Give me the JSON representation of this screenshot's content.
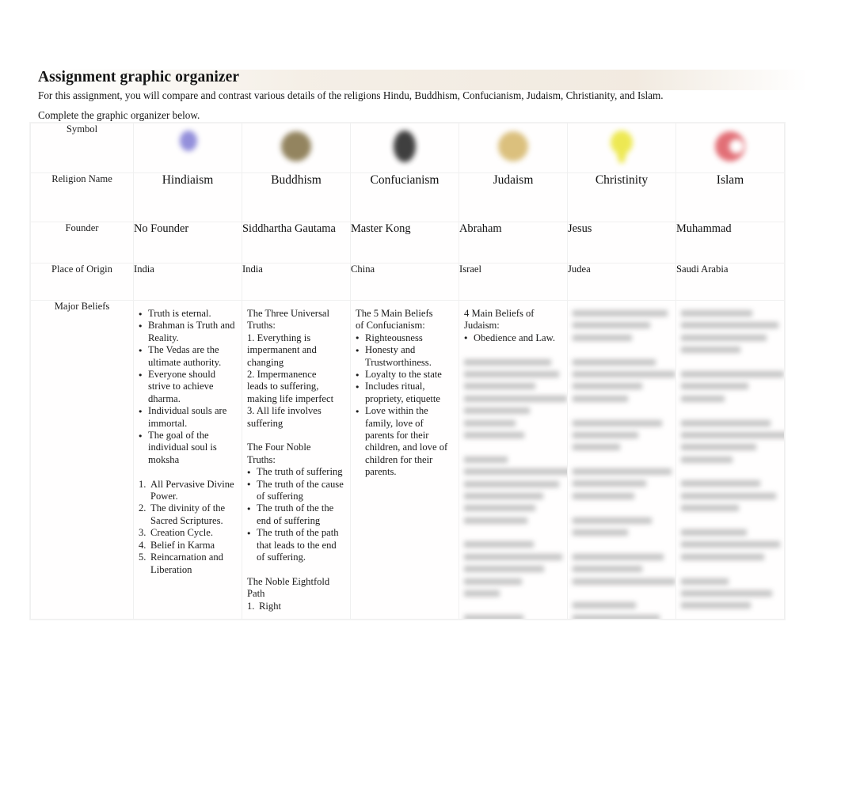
{
  "document": {
    "title": "Assignment graphic organizer",
    "intro_line_1": "For this assignment, you will compare and contrast various details of the religions Hindu, Buddhism, Confucianism, Judaism, Christianity, and Islam.",
    "intro_line_2": "Complete the graphic organizer below."
  },
  "table": {
    "row_labels": {
      "symbol": "Symbol",
      "religion_name": "Religion Name",
      "founder": "Founder",
      "place_of_origin": "Place of Origin",
      "major_beliefs": "Major Beliefs"
    },
    "columns": [
      {
        "religion_name": "Hindiaism",
        "founder": "No Founder",
        "place_of_origin": "India",
        "symbol": {
          "icon_name": "om-symbol-icon",
          "color": "#8a86d8",
          "legible": false
        },
        "major_beliefs": {
          "legible": true,
          "blocks": [
            {
              "type": "bullets",
              "items": [
                "Truth is eternal.",
                "Brahman is Truth and Reality.",
                "The Vedas are the ultimate authority.",
                "Everyone should strive to achieve dharma.",
                "Individual souls are immortal.",
                "The goal of the individual soul is moksha"
              ]
            },
            {
              "type": "blank"
            },
            {
              "type": "numbers",
              "items": [
                "All Pervasive Divine Power.",
                "The divinity of the Sacred Scriptures.",
                "Creation Cycle.",
                "Belief in Karma",
                "Reincarnation and Liberation"
              ]
            }
          ]
        }
      },
      {
        "religion_name": "Buddhism",
        "founder": "Siddhartha Gautama",
        "place_of_origin": "India",
        "symbol": {
          "icon_name": "dharma-wheel-icon",
          "color": "#8a7a52",
          "legible": false
        },
        "major_beliefs": {
          "legible": true,
          "blocks": [
            {
              "type": "plain",
              "lines": [
                "The Three Universal",
                "Truths:",
                "1. Everything is",
                "impermanent and",
                "changing",
                "2. Impermanence",
                "leads to suffering,",
                "making life imperfect",
                "3. All life involves",
                "suffering"
              ]
            },
            {
              "type": "blank"
            },
            {
              "type": "plain",
              "lines": [
                "The Four Noble",
                "Truths:"
              ]
            },
            {
              "type": "bullets",
              "items": [
                "The truth of suffering",
                "The truth of the cause of suffering",
                "The truth of the the end of suffering",
                "The truth of the path that leads to the end of suffering."
              ]
            },
            {
              "type": "blank"
            },
            {
              "type": "plain",
              "lines": [
                "The Noble Eightfold",
                "Path"
              ]
            },
            {
              "type": "numbers",
              "items": [
                "Right"
              ]
            }
          ]
        }
      },
      {
        "religion_name": "Confucianism",
        "founder": "Master Kong",
        "place_of_origin": "China",
        "symbol": {
          "icon_name": "yin-yang-icon",
          "color": "#2f2f2f",
          "legible": false
        },
        "major_beliefs": {
          "legible": true,
          "blocks": [
            {
              "type": "plain",
              "lines": [
                "The 5 Main Beliefs",
                "of Confucianism:"
              ]
            },
            {
              "type": "bullets",
              "items": [
                "Righteousness",
                "Honesty and Trustworthiness.",
                "Loyalty to the state",
                "Includes ritual, propriety, etiquette",
                "Love within the family, love of parents for their children, and love of children for their parents."
              ]
            }
          ]
        }
      },
      {
        "religion_name": "Judaism",
        "founder": "Abraham",
        "place_of_origin": "Israel",
        "symbol": {
          "icon_name": "star-of-david-icon",
          "color": "#d8bb73",
          "legible": false
        },
        "major_beliefs": {
          "legible": "partial",
          "blocks": [
            {
              "type": "plain",
              "lines": [
                "4 Main Beliefs of",
                "Judaism:"
              ]
            },
            {
              "type": "bullets",
              "items": [
                "Obedience and Law."
              ]
            },
            {
              "type": "blank"
            },
            {
              "type": "illegible",
              "note": "blurred text — not readable",
              "line_widths": [
                88,
                96,
                72,
                104,
                66,
                52,
                61,
                0,
                44,
                110,
                96,
                80,
                72,
                64,
                0,
                70,
                99,
                81,
                58,
                36,
                0,
                60,
                92,
                74,
                48,
                0,
                86,
                102
              ]
            }
          ]
        }
      },
      {
        "religion_name": "Christinity",
        "founder": "Jesus",
        "place_of_origin": "Judea",
        "symbol": {
          "icon_name": "cross-icon",
          "color": "#ece745",
          "legible": false
        },
        "major_beliefs": {
          "legible": false,
          "blocks": [
            {
              "type": "illegible",
              "note": "blurred text — not readable",
              "line_widths": [
                96,
                78,
                60,
                0,
                84,
                104,
                70,
                56,
                0,
                90,
                66,
                48,
                0,
                100,
                74,
                62,
                0,
                80,
                56,
                0,
                92,
                70,
                104,
                0,
                64,
                88
              ]
            }
          ]
        }
      },
      {
        "religion_name": "Islam",
        "founder": "Muhammad",
        "place_of_origin": "Saudi Arabia",
        "symbol": {
          "icon_name": "star-and-crescent-icon",
          "color": "#e0636b",
          "legible": false
        },
        "major_beliefs": {
          "legible": false,
          "blocks": [
            {
              "type": "illegible",
              "note": "blurred text — not readable",
              "line_widths": [
                72,
                98,
                86,
                60,
                0,
                104,
                68,
                44,
                0,
                90,
                112,
                76,
                52,
                0,
                80,
                96,
                58,
                0,
                66,
                100,
                84,
                0,
                48,
                92,
                70,
                0,
                86,
                104
              ]
            }
          ]
        }
      }
    ]
  }
}
